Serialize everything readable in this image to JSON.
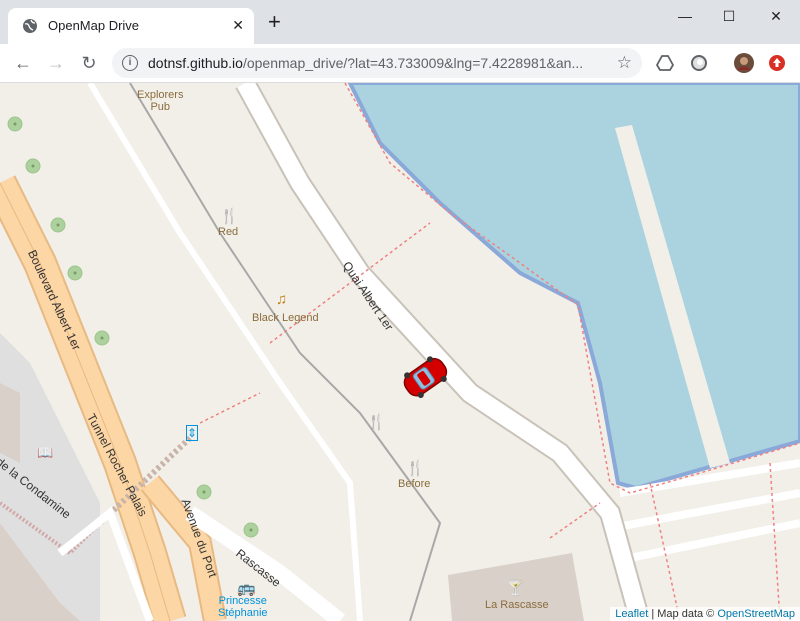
{
  "browser": {
    "tab_title": "OpenMap Drive",
    "url_host": "dotnsf.github.io",
    "url_path": "/openmap_drive/?lat=43.733009&lng=7.4228981&an..."
  },
  "map": {
    "streets": [
      "Quai Albert 1er",
      "Boulevard Albert 1er",
      "Tunnel Rocher Palais",
      "Avenue du Port",
      "Rascasse",
      "de la Condamine"
    ],
    "pois": [
      {
        "name": "Explorers\nPub",
        "icon": "bar-icon"
      },
      {
        "name": "Red",
        "icon": "restaurant-icon"
      },
      {
        "name": "Black Legend",
        "icon": "music-icon"
      },
      {
        "name": "",
        "icon": "restaurant-icon"
      },
      {
        "name": "Before",
        "icon": "restaurant-icon"
      },
      {
        "name": "La Rascasse",
        "icon": "cocktail-icon"
      },
      {
        "name": "Princesse\nStéphanie",
        "icon": "bus-icon"
      }
    ],
    "marker": "car-icon"
  },
  "attribution": {
    "leaflet": "Leaflet",
    "sep": " | Map data © ",
    "osm": "OpenStreetMap"
  },
  "colors": {
    "water": "#aad3df",
    "land": "#f2efe9",
    "primary_road": "#fcd6a4",
    "car": "#d40000"
  }
}
